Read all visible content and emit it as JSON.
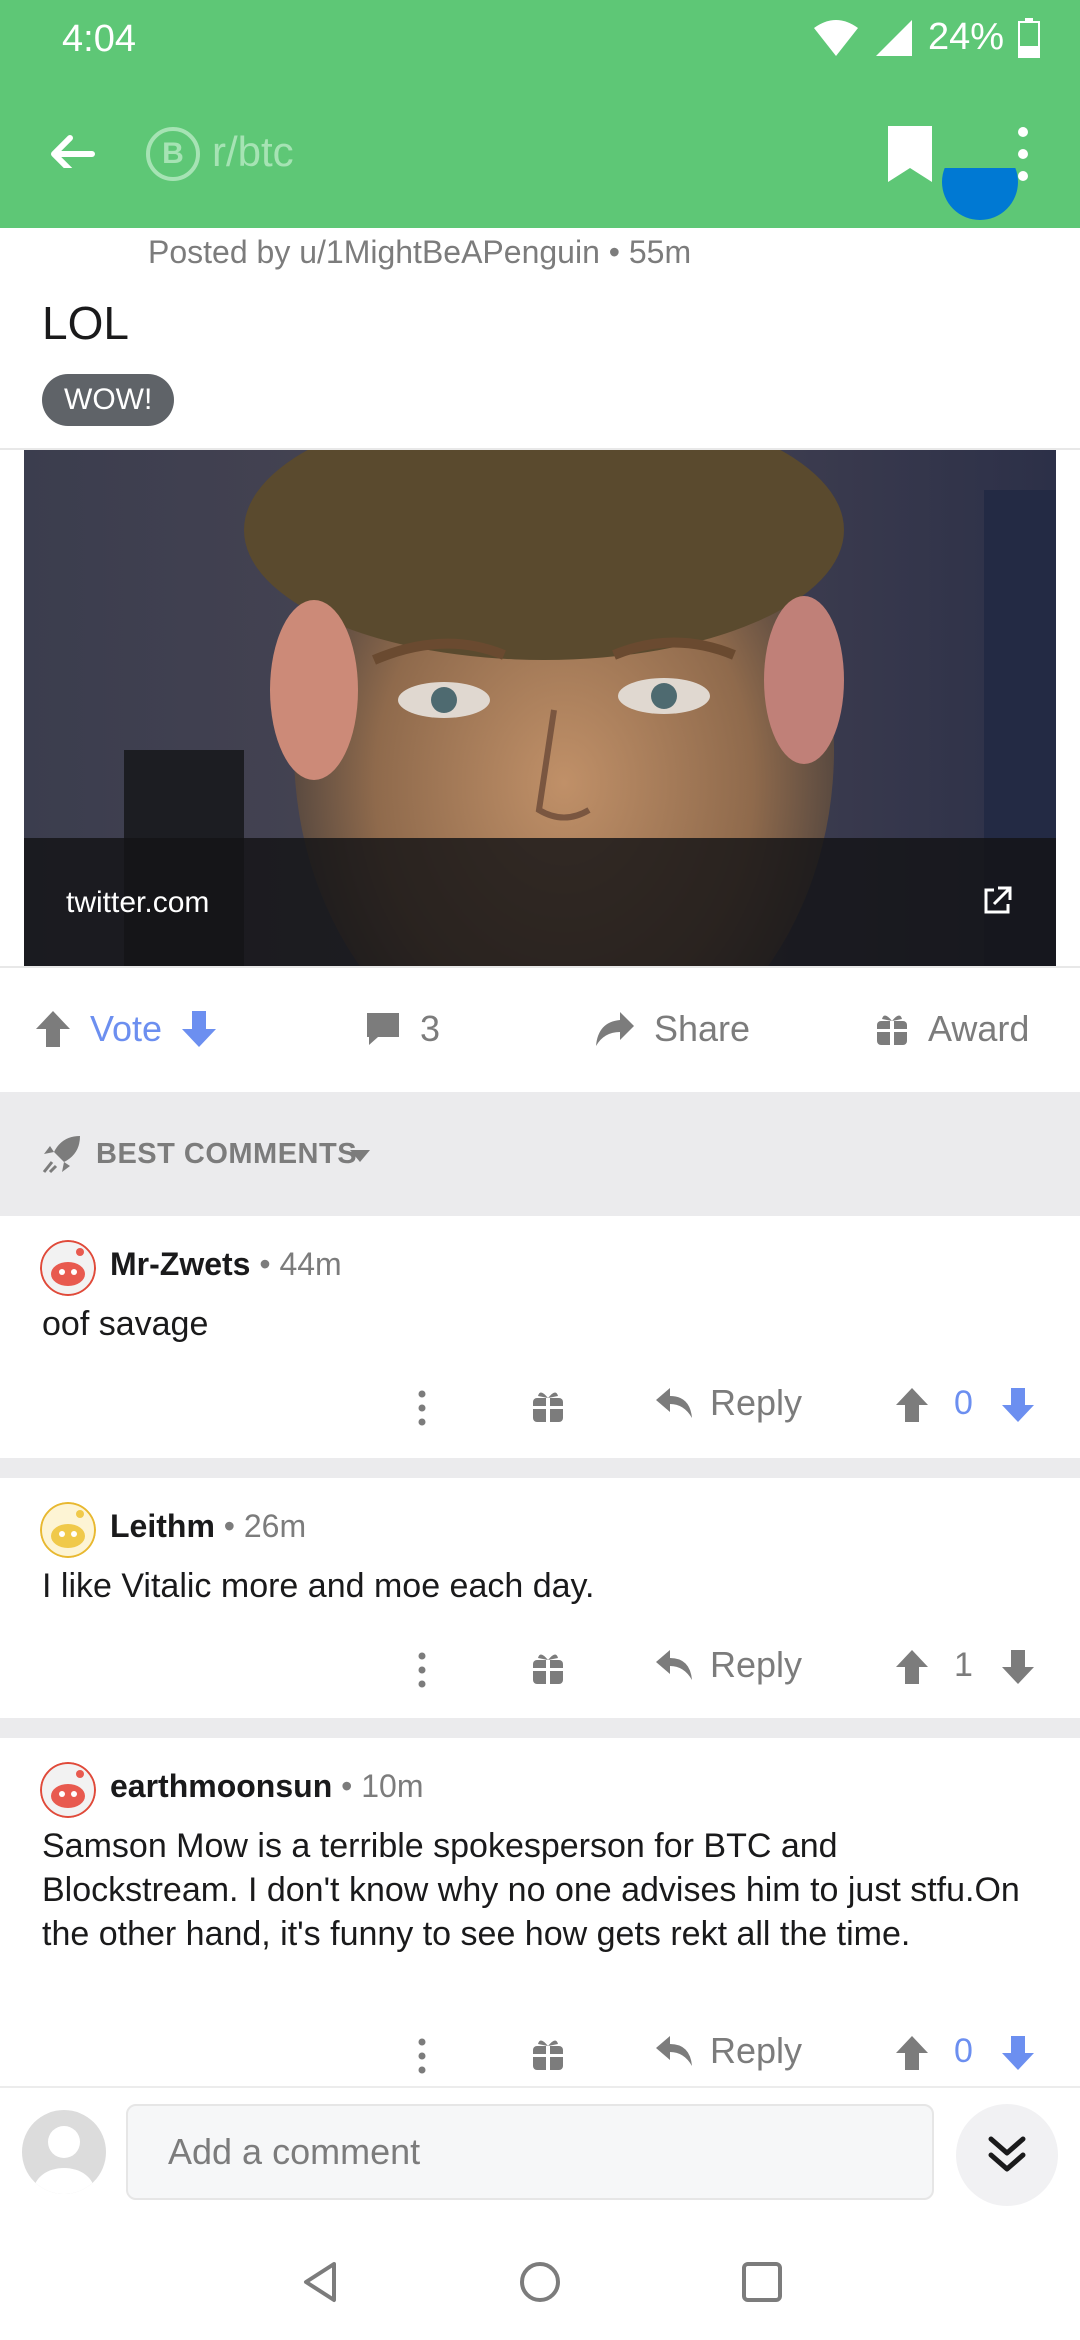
{
  "status_bar": {
    "time": "4:04",
    "battery": "24%"
  },
  "toolbar": {
    "subreddit": "r/btc",
    "subreddit_icon_letter": "B"
  },
  "post": {
    "posted_by": "Posted by u/1MightBeAPenguin • 55m",
    "title": "LOL",
    "flair": "WOW!",
    "link_domain": "twitter.com"
  },
  "actions": {
    "vote_label": "Vote",
    "comment_count": "3",
    "share_label": "Share",
    "award_label": "Award"
  },
  "sort": {
    "label": "BEST COMMENTS"
  },
  "comments": [
    {
      "author": "Mr-Zwets",
      "time": " • 44m",
      "body": "oof savage",
      "reply": "Reply",
      "score": "0",
      "score_color": "#6c8ff0"
    },
    {
      "author": "Leithm",
      "time": " • 26m",
      "body": "I like Vitalic more and moe each day.",
      "reply": "Reply",
      "score": "1",
      "score_color": "#7c7c7c"
    },
    {
      "author": "earthmoonsun",
      "time": " • 10m",
      "body": "Samson Mow is a terrible spokesperson for BTC and Blockstream. I don't know why no one advises him to just stfu.On the other hand, it's funny to see how gets rekt all the time.",
      "reply": "Reply",
      "score": "0",
      "score_color": "#6c8ff0"
    }
  ],
  "composer": {
    "placeholder": "Add a comment"
  },
  "colors": {
    "brand_green": "#5ec776",
    "upvote_blue": "#6c8ff0",
    "join_blue": "#0079d3",
    "flair_gray": "#5f6368"
  },
  "icons": [
    "wifi-icon",
    "signal-icon",
    "battery-icon",
    "back-arrow-icon",
    "bitcoin-icon",
    "bookmark-icon",
    "more-vert-icon",
    "external-link-icon",
    "upvote-icon",
    "downvote-icon",
    "comment-icon",
    "share-icon",
    "gift-icon",
    "rocket-icon",
    "reply-icon",
    "double-chevron-down-icon",
    "nav-back-icon",
    "nav-home-icon",
    "nav-recents-icon"
  ]
}
